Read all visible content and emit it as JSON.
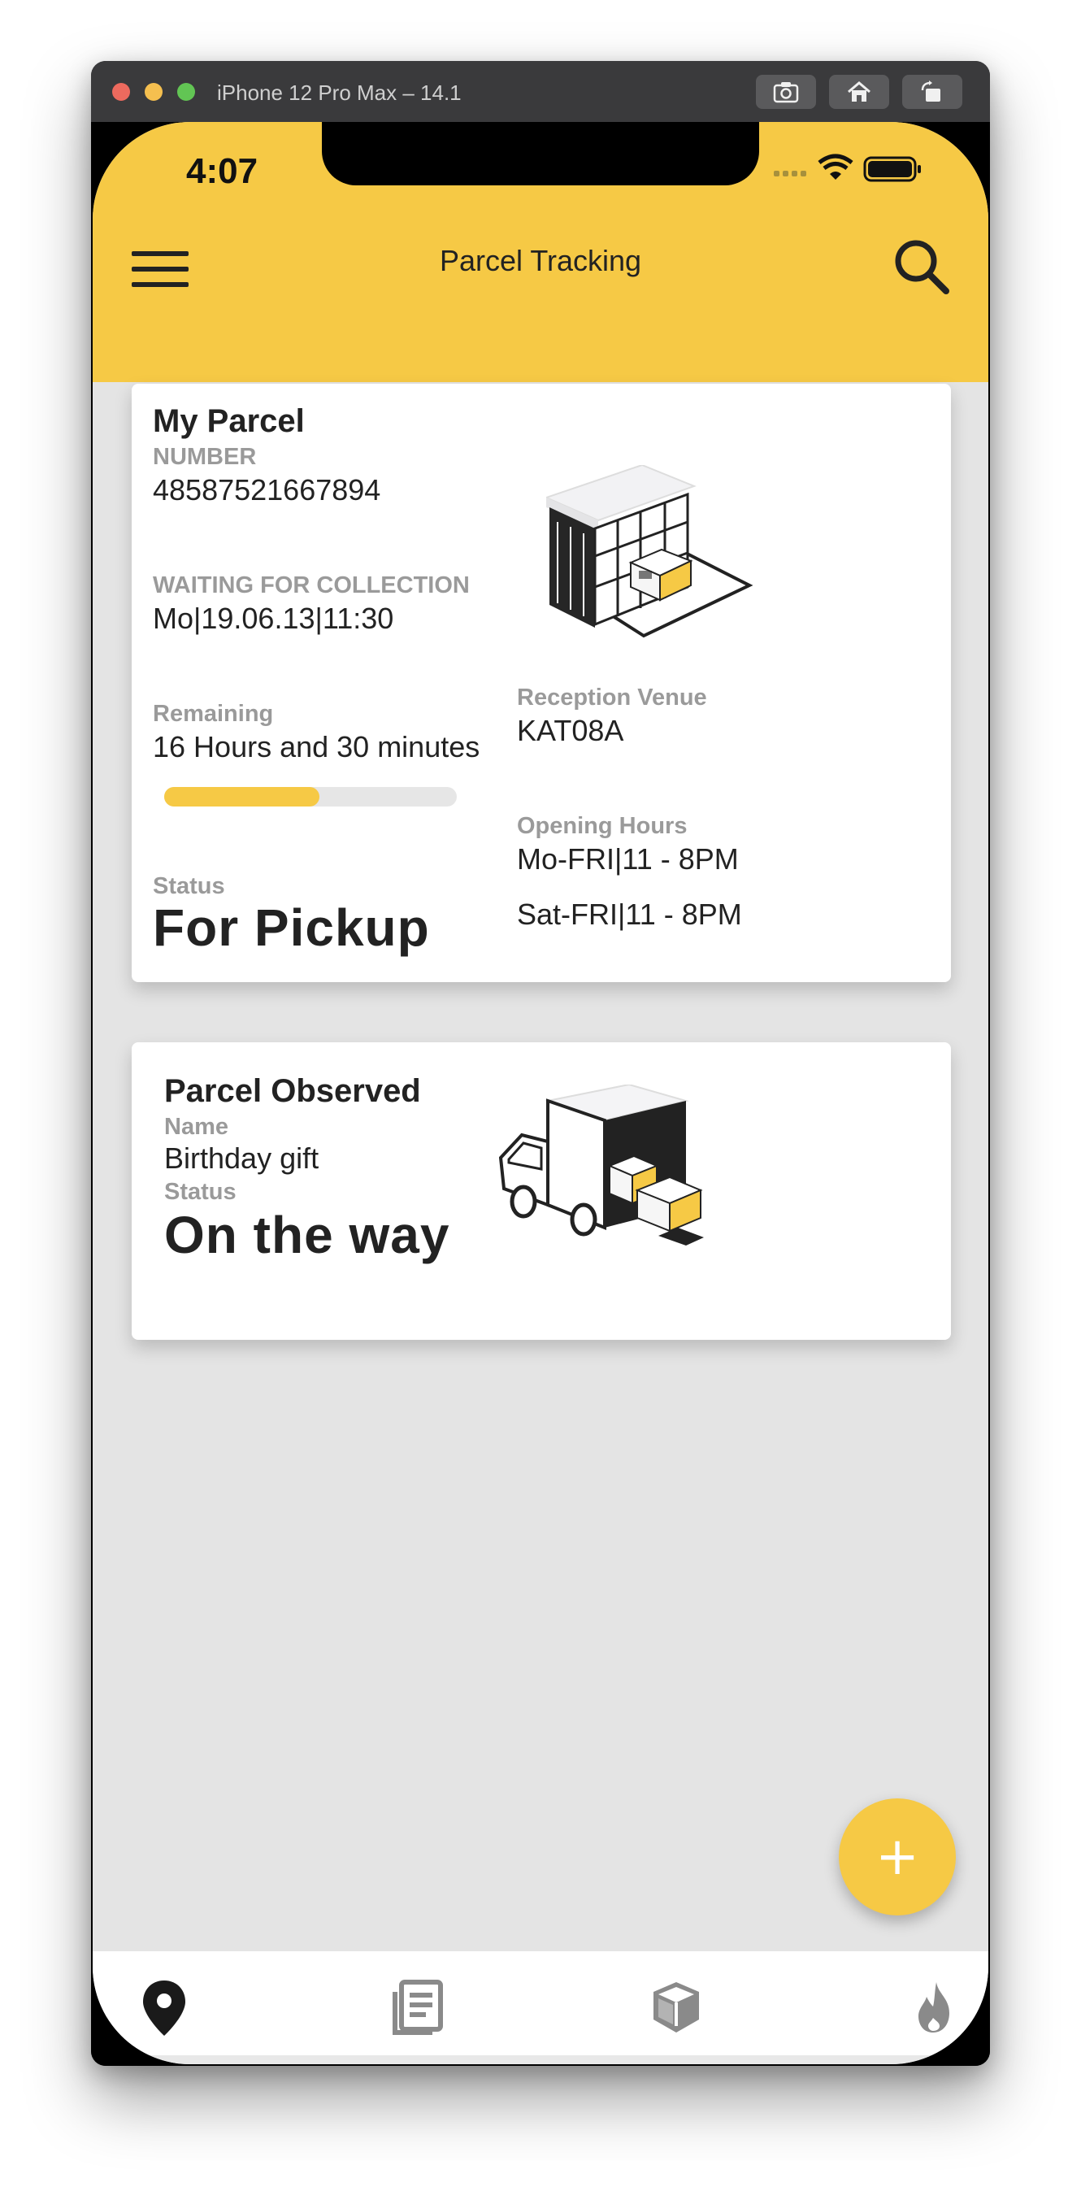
{
  "window": {
    "title": "iPhone 12 Pro Max – 14.1"
  },
  "status_bar": {
    "time": "4:07"
  },
  "header": {
    "title": "Parcel Tracking"
  },
  "my_parcel": {
    "title": "My Parcel",
    "number_label": "NUMBER",
    "number_value": "48587521667894",
    "collection_label": "WAITING FOR COLLECTION",
    "collection_value": "Mo|19.06.13|11:30",
    "remaining_label": "Remaining",
    "remaining_value": "16 Hours and 30 minutes",
    "remaining_progress": 0.53,
    "status_label": "Status",
    "status_value": "For Pickup",
    "reception_label": "Reception Venue",
    "reception_value": "KAT08A",
    "hours_label": "Opening Hours",
    "hours_line1": "Mo-FRI|11 - 8PM",
    "hours_line2": "Sat-FRI|11 - 8PM"
  },
  "observed_parcel": {
    "title": "Parcel Observed",
    "name_label": "Name",
    "name_value": "Birthday gift",
    "status_label": "Status",
    "status_value": "On the way"
  },
  "fab": {
    "label": "+"
  },
  "bottom_nav": {
    "items": [
      {
        "icon": "location-pin-icon",
        "active": true
      },
      {
        "icon": "news-icon",
        "active": false
      },
      {
        "icon": "package-icon",
        "active": false
      },
      {
        "icon": "flame-icon",
        "active": false
      }
    ]
  },
  "colors": {
    "accent": "#f6c945",
    "background": "#e4e4e4",
    "text": "#222222",
    "muted": "#9a9a9a"
  }
}
